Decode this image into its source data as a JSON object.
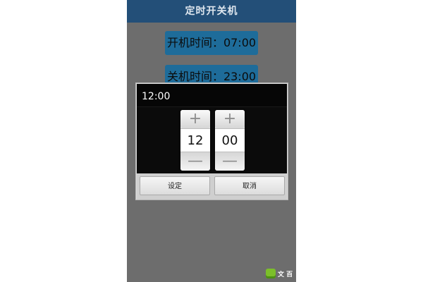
{
  "app": {
    "title": "定时开关机"
  },
  "schedule": {
    "power_on_label": "开机时间：07:00",
    "power_off_label": "关机时间：23:00"
  },
  "time_picker_dialog": {
    "header_time": "12:00",
    "hour": {
      "value": "12",
      "increment_symbol": "+",
      "decrement_symbol": "—"
    },
    "minute": {
      "value": "00",
      "increment_symbol": "+",
      "decrement_symbol": "—"
    },
    "buttons": {
      "set_label": "设定",
      "cancel_label": "取消"
    }
  },
  "watermark": {
    "text": "文 百",
    "icon": "logo-icon"
  },
  "colors": {
    "titlebar": "#234f78",
    "button_accent": "#1e6c9a",
    "dim_overlay": "#6d6d6d",
    "dialog_dark": "#0b0b0b"
  }
}
